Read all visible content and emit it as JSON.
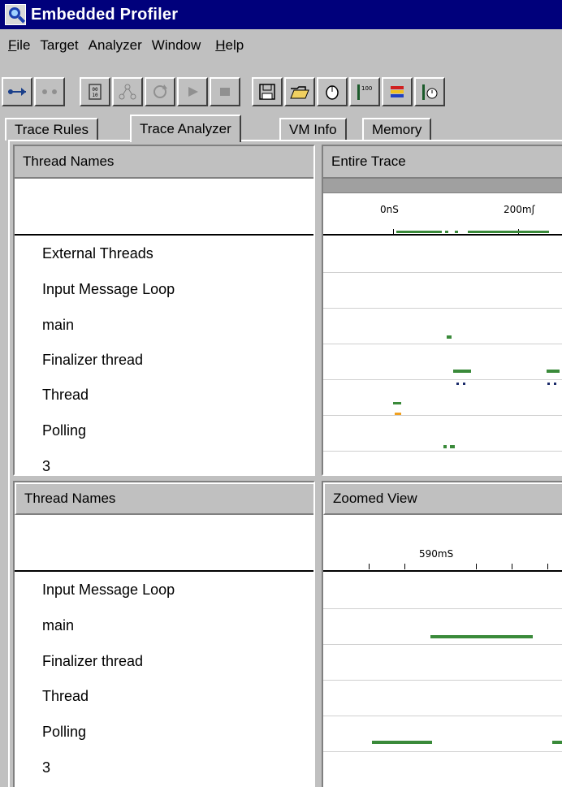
{
  "app": {
    "title": "Embedded Profiler",
    "icon": "magnifier-icon"
  },
  "menu": {
    "items": [
      {
        "mnemonic": "F",
        "rest": "ile"
      },
      {
        "mnemonic": "",
        "rest": "Target"
      },
      {
        "mnemonic": "",
        "rest": "Analyzer"
      },
      {
        "mnemonic": "",
        "rest": "Window"
      },
      {
        "mnemonic": "H",
        "rest": "elp"
      }
    ]
  },
  "toolbar": {
    "buttons": [
      "connect-icon",
      "disconnect-icon",
      "hex-view-icon",
      "graph-icon",
      "refresh-icon",
      "play-icon",
      "stop-icon",
      "save-icon",
      "open-folder-icon",
      "mouse-icon",
      "flag-100-icon",
      "color-bars-icon",
      "time-icon"
    ]
  },
  "tabs": [
    "Trace Rules",
    "Trace Analyzer",
    "VM Info",
    "Memory"
  ],
  "active_tab": "Trace Analyzer",
  "top": {
    "names_header": "Thread Names",
    "view_header": "Entire Trace",
    "ruler_labels": [
      "0nS",
      "200mʃ"
    ],
    "threads": [
      "External Threads",
      "Input Message Loop",
      "main",
      "Finalizer thread",
      "Thread",
      "Polling",
      "3"
    ]
  },
  "bottom": {
    "names_header": "Thread Names",
    "view_header": "Zoomed View",
    "ruler_labels": [
      "590mS"
    ],
    "threads": [
      "Input Message Loop",
      "main",
      "Finalizer thread",
      "Thread",
      "Polling",
      "3"
    ]
  },
  "colors": {
    "title_bg": "#00007b",
    "trace_green": "#3a8a3a",
    "trace_orange": "#f0a020",
    "trace_blue": "#1a2a6a"
  }
}
